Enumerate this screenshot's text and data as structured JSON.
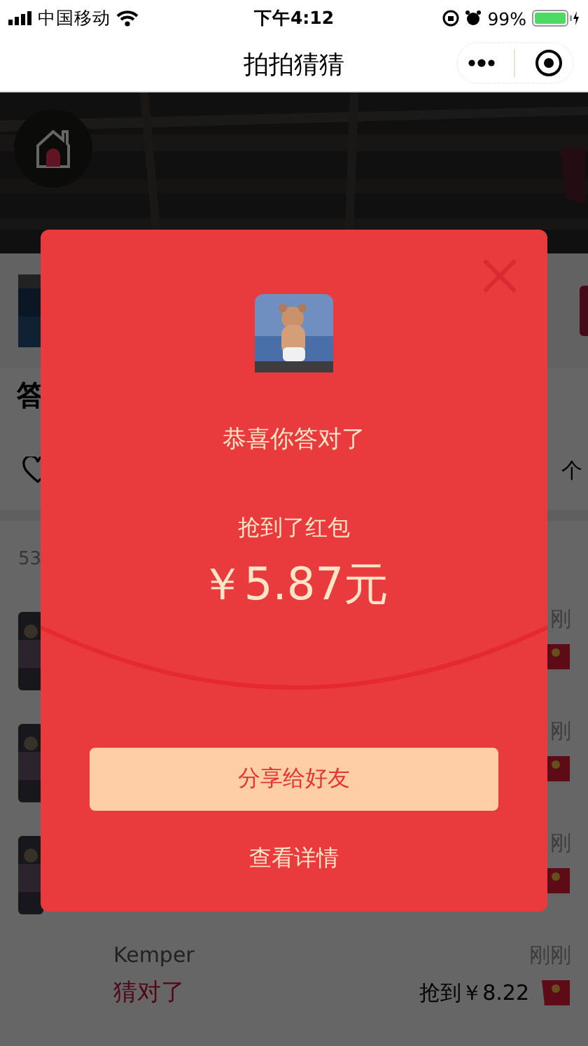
{
  "status_bar": {
    "carrier": "中国移动",
    "time": "下午4:12",
    "battery": "99%"
  },
  "nav": {
    "title": "拍拍猜猜"
  },
  "page": {
    "heading": "答",
    "stat": "个",
    "count": "53",
    "rows": [
      {
        "time": "刚"
      },
      {
        "time": "刚"
      },
      {
        "time": "刚"
      },
      {
        "kind": "guess",
        "name": "Kemper",
        "result": "猜对了",
        "time": "刚刚",
        "prize": "抢到￥8.22"
      }
    ]
  },
  "modal": {
    "title": "恭喜你答对了",
    "subtitle": "抢到了红包",
    "amount": "￥5.87元",
    "share_button": "分享给好友",
    "details_link": "查看详情"
  }
}
